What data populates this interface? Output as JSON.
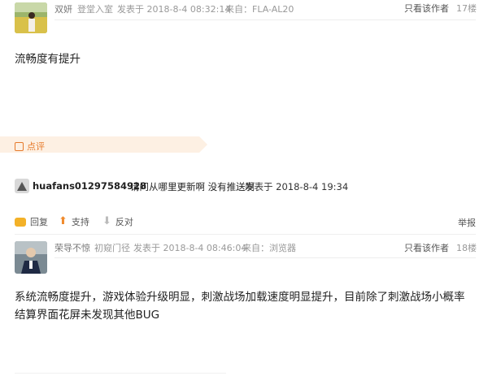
{
  "post1": {
    "username": "双妍",
    "role": "登堂入室",
    "posted": "发表于 2018-8-4 08:32:14",
    "source": "来自：FLA-AL20",
    "only_author": "只看该作者",
    "floor": "17楼",
    "content": "流畅度有提升"
  },
  "comment_tab": {
    "label": "点评"
  },
  "reply": {
    "username": "huafans01297584928",
    "text": "请问从哪里更新啊 没有推送啊",
    "time": "发表于 2018-8-4 19:34"
  },
  "actions": {
    "reply": "回复",
    "support": "支持",
    "oppose": "反对",
    "report": "举报"
  },
  "post2": {
    "username": "荣导不惊",
    "role": "初窥门径",
    "posted": "发表于 2018-8-4 08:46:04",
    "source": "来自：浏览器",
    "only_author": "只看该作者",
    "floor": "18楼",
    "content_line1": "系统流畅度提升，游戏体验升级明显，刺激战场加载速度明显提升，目前除了刺激战场小概率",
    "content_line2": "结算界面花屏未发现其他BUG"
  },
  "colors": {
    "accent": "#f08a2c",
    "tab_bg": "#fdf0e3"
  }
}
